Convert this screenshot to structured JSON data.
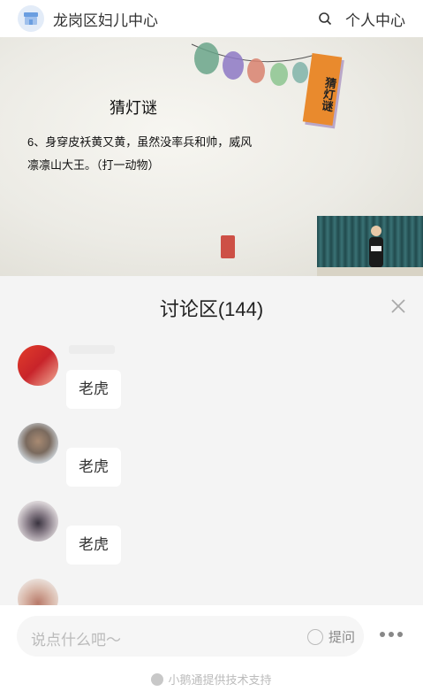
{
  "header": {
    "title": "龙岗区妇儿中心",
    "personal_label": "个人中心"
  },
  "slide": {
    "title": "猜灯谜",
    "riddle": "6、身穿皮袄黄又黄，虽然没率兵和帅，威风凛凛山大王。（打一动物）",
    "banner": "猜灯谜"
  },
  "discussion": {
    "title": "讨论区(144)",
    "messages": [
      {
        "text": "老虎"
      },
      {
        "text": "老虎"
      },
      {
        "text": "老虎"
      }
    ]
  },
  "footer": {
    "input_placeholder": "说点什么吧～",
    "ask_label": "提问",
    "support_text": "小鹅通提供技术支持"
  },
  "colors": {
    "banner": "#e98a2d",
    "seal": "#c8352a",
    "panel_bg": "#f4f4f4"
  }
}
